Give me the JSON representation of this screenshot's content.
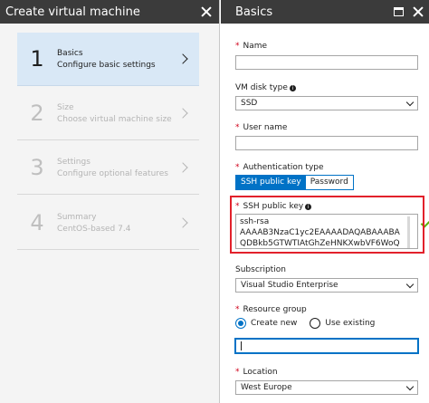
{
  "left_blade": {
    "title": "Create virtual machine",
    "steps": [
      {
        "number": "1",
        "title": "Basics",
        "subtitle": "Configure basic settings",
        "active": true
      },
      {
        "number": "2",
        "title": "Size",
        "subtitle": "Choose virtual machine size",
        "active": false
      },
      {
        "number": "3",
        "title": "Settings",
        "subtitle": "Configure optional features",
        "active": false
      },
      {
        "number": "4",
        "title": "Summary",
        "subtitle": "CentOS-based 7.4",
        "active": false
      }
    ]
  },
  "right_blade": {
    "title": "Basics",
    "name": {
      "label": "Name",
      "required": "*",
      "value": ""
    },
    "vm_disk_type": {
      "label": "VM disk type",
      "value": "SSD"
    },
    "user_name": {
      "label": "User name",
      "required": "*",
      "value": ""
    },
    "authentication_type": {
      "label": "Authentication type",
      "required": "*",
      "options": [
        "SSH public key",
        "Password"
      ],
      "selected": "SSH public key"
    },
    "ssh_public_key": {
      "label": "SSH public key",
      "required": "*",
      "lines": [
        "ssh-rsa",
        "AAAAB3NzaC1yc2EAAAADAQABAAABA",
        "QDBkb5GTWTIAtGhZeHNKXwbVF6WoQ"
      ]
    },
    "subscription": {
      "label": "Subscription",
      "value": "Visual Studio Enterprise"
    },
    "resource_group": {
      "label": "Resource group",
      "required": "*",
      "options": [
        "Create new",
        "Use existing"
      ],
      "selected": "Create new",
      "value": ""
    },
    "location": {
      "label": "Location",
      "required": "*",
      "value": "West Europe"
    }
  },
  "colors": {
    "header_bg": "#3b3b3b",
    "active_step_bg": "#d9e8f6",
    "accent": "#0072c6",
    "required": "#d0021b",
    "highlight_border": "#e2212b",
    "valid_check": "#59b300"
  },
  "icons": [
    "close-icon",
    "chevron-right-icon",
    "maximize-icon",
    "info-icon",
    "chevron-down-icon",
    "checkmark-icon"
  ]
}
